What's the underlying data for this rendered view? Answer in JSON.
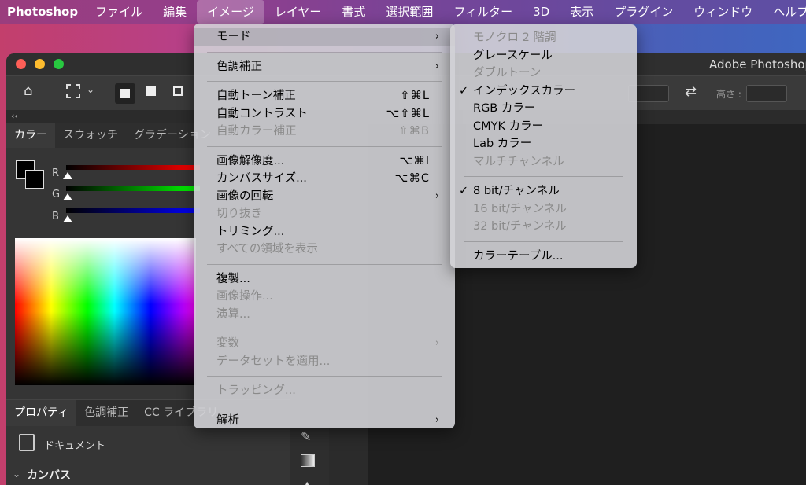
{
  "menubar": {
    "app": "Photoshop",
    "items": [
      "ファイル",
      "編集",
      "イメージ",
      "レイヤー",
      "書式",
      "選択範囲",
      "フィルター",
      "3D",
      "表示",
      "プラグイン",
      "ウィンドウ",
      "ヘルプ"
    ],
    "active_index": 2
  },
  "window": {
    "title": "Adobe Photoshop",
    "collapse_glyph": "‹‹",
    "height_label": "高さ :"
  },
  "color_panel": {
    "tabs": [
      "カラー",
      "スウォッチ",
      "グラデーション"
    ],
    "channels": [
      "R",
      "G",
      "B"
    ]
  },
  "properties_panel": {
    "tabs": [
      "プロパティ",
      "色調補正",
      "CC ライブラリ"
    ],
    "document_label": "ドキュメント",
    "section": "カンバス"
  },
  "image_menu": {
    "groups": [
      [
        {
          "label": "モード",
          "submenu": true,
          "highlight": true
        }
      ],
      [
        {
          "label": "色調補正",
          "submenu": true
        }
      ],
      [
        {
          "label": "自動トーン補正",
          "shortcut": "⇧⌘L"
        },
        {
          "label": "自動コントラスト",
          "shortcut": "⌥⇧⌘L"
        },
        {
          "label": "自動カラー補正",
          "shortcut": "⇧⌘B",
          "disabled": true
        }
      ],
      [
        {
          "label": "画像解像度...",
          "shortcut": "⌥⌘I"
        },
        {
          "label": "カンバスサイズ...",
          "shortcut": "⌥⌘C"
        },
        {
          "label": "画像の回転",
          "submenu": true
        },
        {
          "label": "切り抜き",
          "disabled": true
        },
        {
          "label": "トリミング..."
        },
        {
          "label": "すべての領域を表示",
          "disabled": true
        }
      ],
      [
        {
          "label": "複製..."
        },
        {
          "label": "画像操作...",
          "disabled": true
        },
        {
          "label": "演算...",
          "disabled": true
        }
      ],
      [
        {
          "label": "変数",
          "submenu": true,
          "disabled": true
        },
        {
          "label": "データセットを適用...",
          "disabled": true
        }
      ],
      [
        {
          "label": "トラッピング...",
          "disabled": true
        }
      ],
      [
        {
          "label": "解析",
          "submenu": true
        }
      ]
    ]
  },
  "mode_menu": {
    "groups": [
      [
        {
          "label": "モノクロ 2 階調",
          "disabled": true
        },
        {
          "label": "グレースケール"
        },
        {
          "label": "ダブルトーン",
          "disabled": true
        },
        {
          "label": "インデックスカラー",
          "checked": true
        },
        {
          "label": "RGB カラー"
        },
        {
          "label": "CMYK カラー"
        },
        {
          "label": "Lab カラー"
        },
        {
          "label": "マルチチャンネル",
          "disabled": true
        }
      ],
      [
        {
          "label": "8 bit/チャンネル",
          "checked": true
        },
        {
          "label": "16 bit/チャンネル",
          "disabled": true
        },
        {
          "label": "32 bit/チャンネル",
          "disabled": true
        }
      ],
      [
        {
          "label": "カラーテーブル..."
        }
      ]
    ],
    "check_glyph": "✓",
    "arrow_glyph": "›"
  }
}
